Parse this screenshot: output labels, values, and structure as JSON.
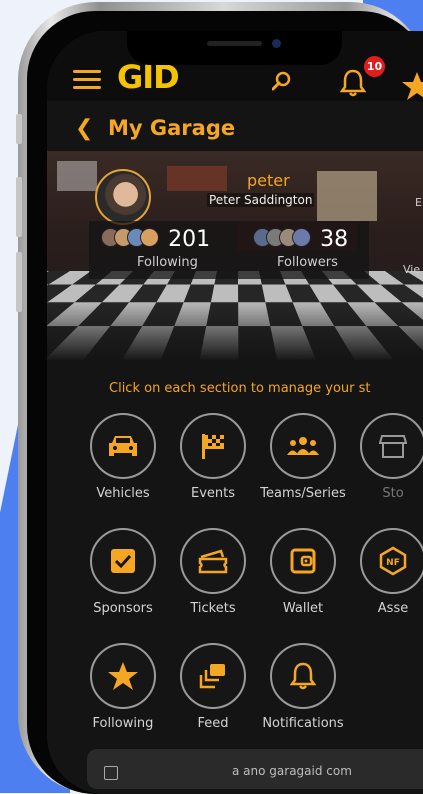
{
  "header": {
    "logo_text": "GID",
    "notification_count": "10",
    "page_title": "My Garage"
  },
  "profile": {
    "username": "peter",
    "full_name": "Peter Saddington",
    "following_count": "201",
    "following_label": "Following",
    "followers_count": "38",
    "followers_label": "Followers",
    "edge_letter": "E",
    "edge_view": "Vie"
  },
  "instruction": "Click on each section to manage your st",
  "sections": [
    {
      "label": "Vehicles",
      "icon": "car-icon"
    },
    {
      "label": "Events",
      "icon": "checkered-flag-icon"
    },
    {
      "label": "Teams/Series",
      "icon": "team-icon"
    },
    {
      "label": "Sto",
      "icon": "store-icon"
    },
    {
      "label": "Sponsors",
      "icon": "checkbox-icon"
    },
    {
      "label": "Tickets",
      "icon": "ticket-icon"
    },
    {
      "label": "Wallet",
      "icon": "wallet-icon"
    },
    {
      "label": "Asse",
      "icon": "nft-icon"
    },
    {
      "label": "Following",
      "icon": "star-icon"
    },
    {
      "label": "Feed",
      "icon": "feed-icon"
    },
    {
      "label": "Notifications",
      "icon": "bell-icon"
    }
  ],
  "browser": {
    "url": "a ano garagaid com"
  },
  "colors": {
    "accent": "#f5a623",
    "background": "#141414",
    "badge": "#e21d1d"
  }
}
